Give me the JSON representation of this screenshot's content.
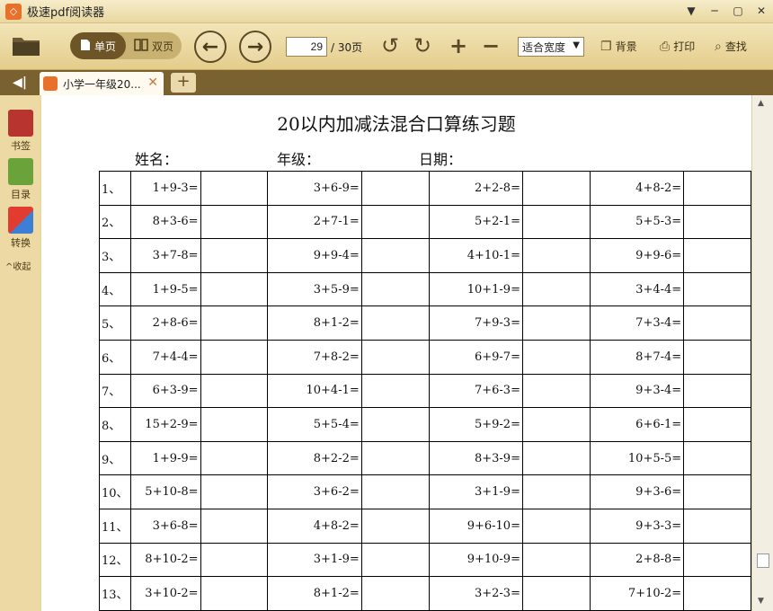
{
  "window": {
    "title": "极速pdf阅读器",
    "logo_glyph": "◇",
    "minimize_glyph": "─",
    "restore_glyph": "▢",
    "close_glyph": "✕",
    "menu_glyph": "▼"
  },
  "toolbar": {
    "single_page_label": "单页",
    "double_page_label": "双页",
    "current_page": "29",
    "total_pages": "/ 30页",
    "zoom_option": "适合宽度",
    "background_label": "背景",
    "print_label": "打印",
    "search_label": "查找"
  },
  "tabs": [
    {
      "label": "小学一年级20..."
    }
  ],
  "sidebar": {
    "bookmark_label": "书签",
    "toc_label": "目录",
    "convert_label": "转换",
    "collapse_label": "收起"
  },
  "document": {
    "title": "20以内加减法混合口算练习题",
    "name_label": "姓名：",
    "grade_label": "年级：",
    "date_label": "日期：",
    "rows": [
      {
        "no": "1、",
        "c": [
          "1+9-3=",
          "3+6-9=",
          "2+2-8=",
          "4+8-2="
        ]
      },
      {
        "no": "2、",
        "c": [
          "8+3-6=",
          "2+7-1=",
          "5+2-1=",
          "5+5-3="
        ]
      },
      {
        "no": "3、",
        "c": [
          "3+7-8=",
          "9+9-4=",
          "4+10-1=",
          "9+9-6="
        ]
      },
      {
        "no": "4、",
        "c": [
          "1+9-5=",
          "3+5-9=",
          "10+1-9=",
          "3+4-4="
        ]
      },
      {
        "no": "5、",
        "c": [
          "2+8-6=",
          "8+1-2=",
          "7+9-3=",
          "7+3-4="
        ]
      },
      {
        "no": "6、",
        "c": [
          "7+4-4=",
          "7+8-2=",
          "6+9-7=",
          "8+7-4="
        ]
      },
      {
        "no": "7、",
        "c": [
          "6+3-9=",
          "10+4-1=",
          "7+6-3=",
          "9+3-4="
        ]
      },
      {
        "no": "8、",
        "c": [
          "15+2-9=",
          "5+5-4=",
          "5+9-2=",
          "6+6-1="
        ]
      },
      {
        "no": "9、",
        "c": [
          "1+9-9=",
          "8+2-2=",
          "8+3-9=",
          "10+5-5="
        ]
      },
      {
        "no": "10、",
        "c": [
          "5+10-8=",
          "3+6-2=",
          "3+1-9=",
          "9+3-6="
        ]
      },
      {
        "no": "11、",
        "c": [
          "3+6-8=",
          "4+8-2=",
          "9+6-10=",
          "9+3-3="
        ]
      },
      {
        "no": "12、",
        "c": [
          "8+10-2=",
          "3+1-9=",
          "9+10-9=",
          "2+8-8="
        ]
      },
      {
        "no": "13、",
        "c": [
          "3+10-2=",
          "8+1-2=",
          "3+2-3=",
          "7+10-2="
        ]
      }
    ]
  },
  "colors": {
    "chrome": "#ecd9a3",
    "tabbar": "#7a6230",
    "accent_logo": "#e8702a"
  }
}
